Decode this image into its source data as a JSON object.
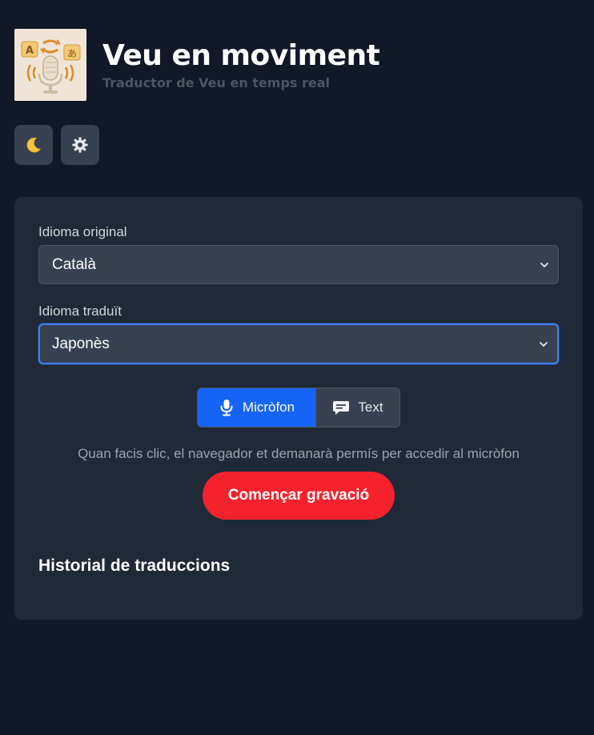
{
  "header": {
    "title": "Veu en moviment",
    "subtitle": "Traductor de Veu en temps real",
    "logo_icon": "microphone-translate-logo"
  },
  "toolbar": {
    "theme_icon": "moon-icon",
    "settings_icon": "gear-icon"
  },
  "form": {
    "source_label": "Idioma original",
    "source_value": "Català",
    "target_label": "Idioma traduït",
    "target_value": "Japonès"
  },
  "mode": {
    "microphone_label": "Micròfon",
    "text_label": "Text",
    "selected": "microphone"
  },
  "hint": "Quan facis clic, el navegador et demanarà permís per accedir al micròfon",
  "record_label": "Començar gravació",
  "history_title": "Historial de traduccions",
  "colors": {
    "background": "#111827",
    "card": "#1f2937",
    "accent": "#1664f5",
    "record": "#f5222d",
    "focus_border": "#3b82f6"
  }
}
